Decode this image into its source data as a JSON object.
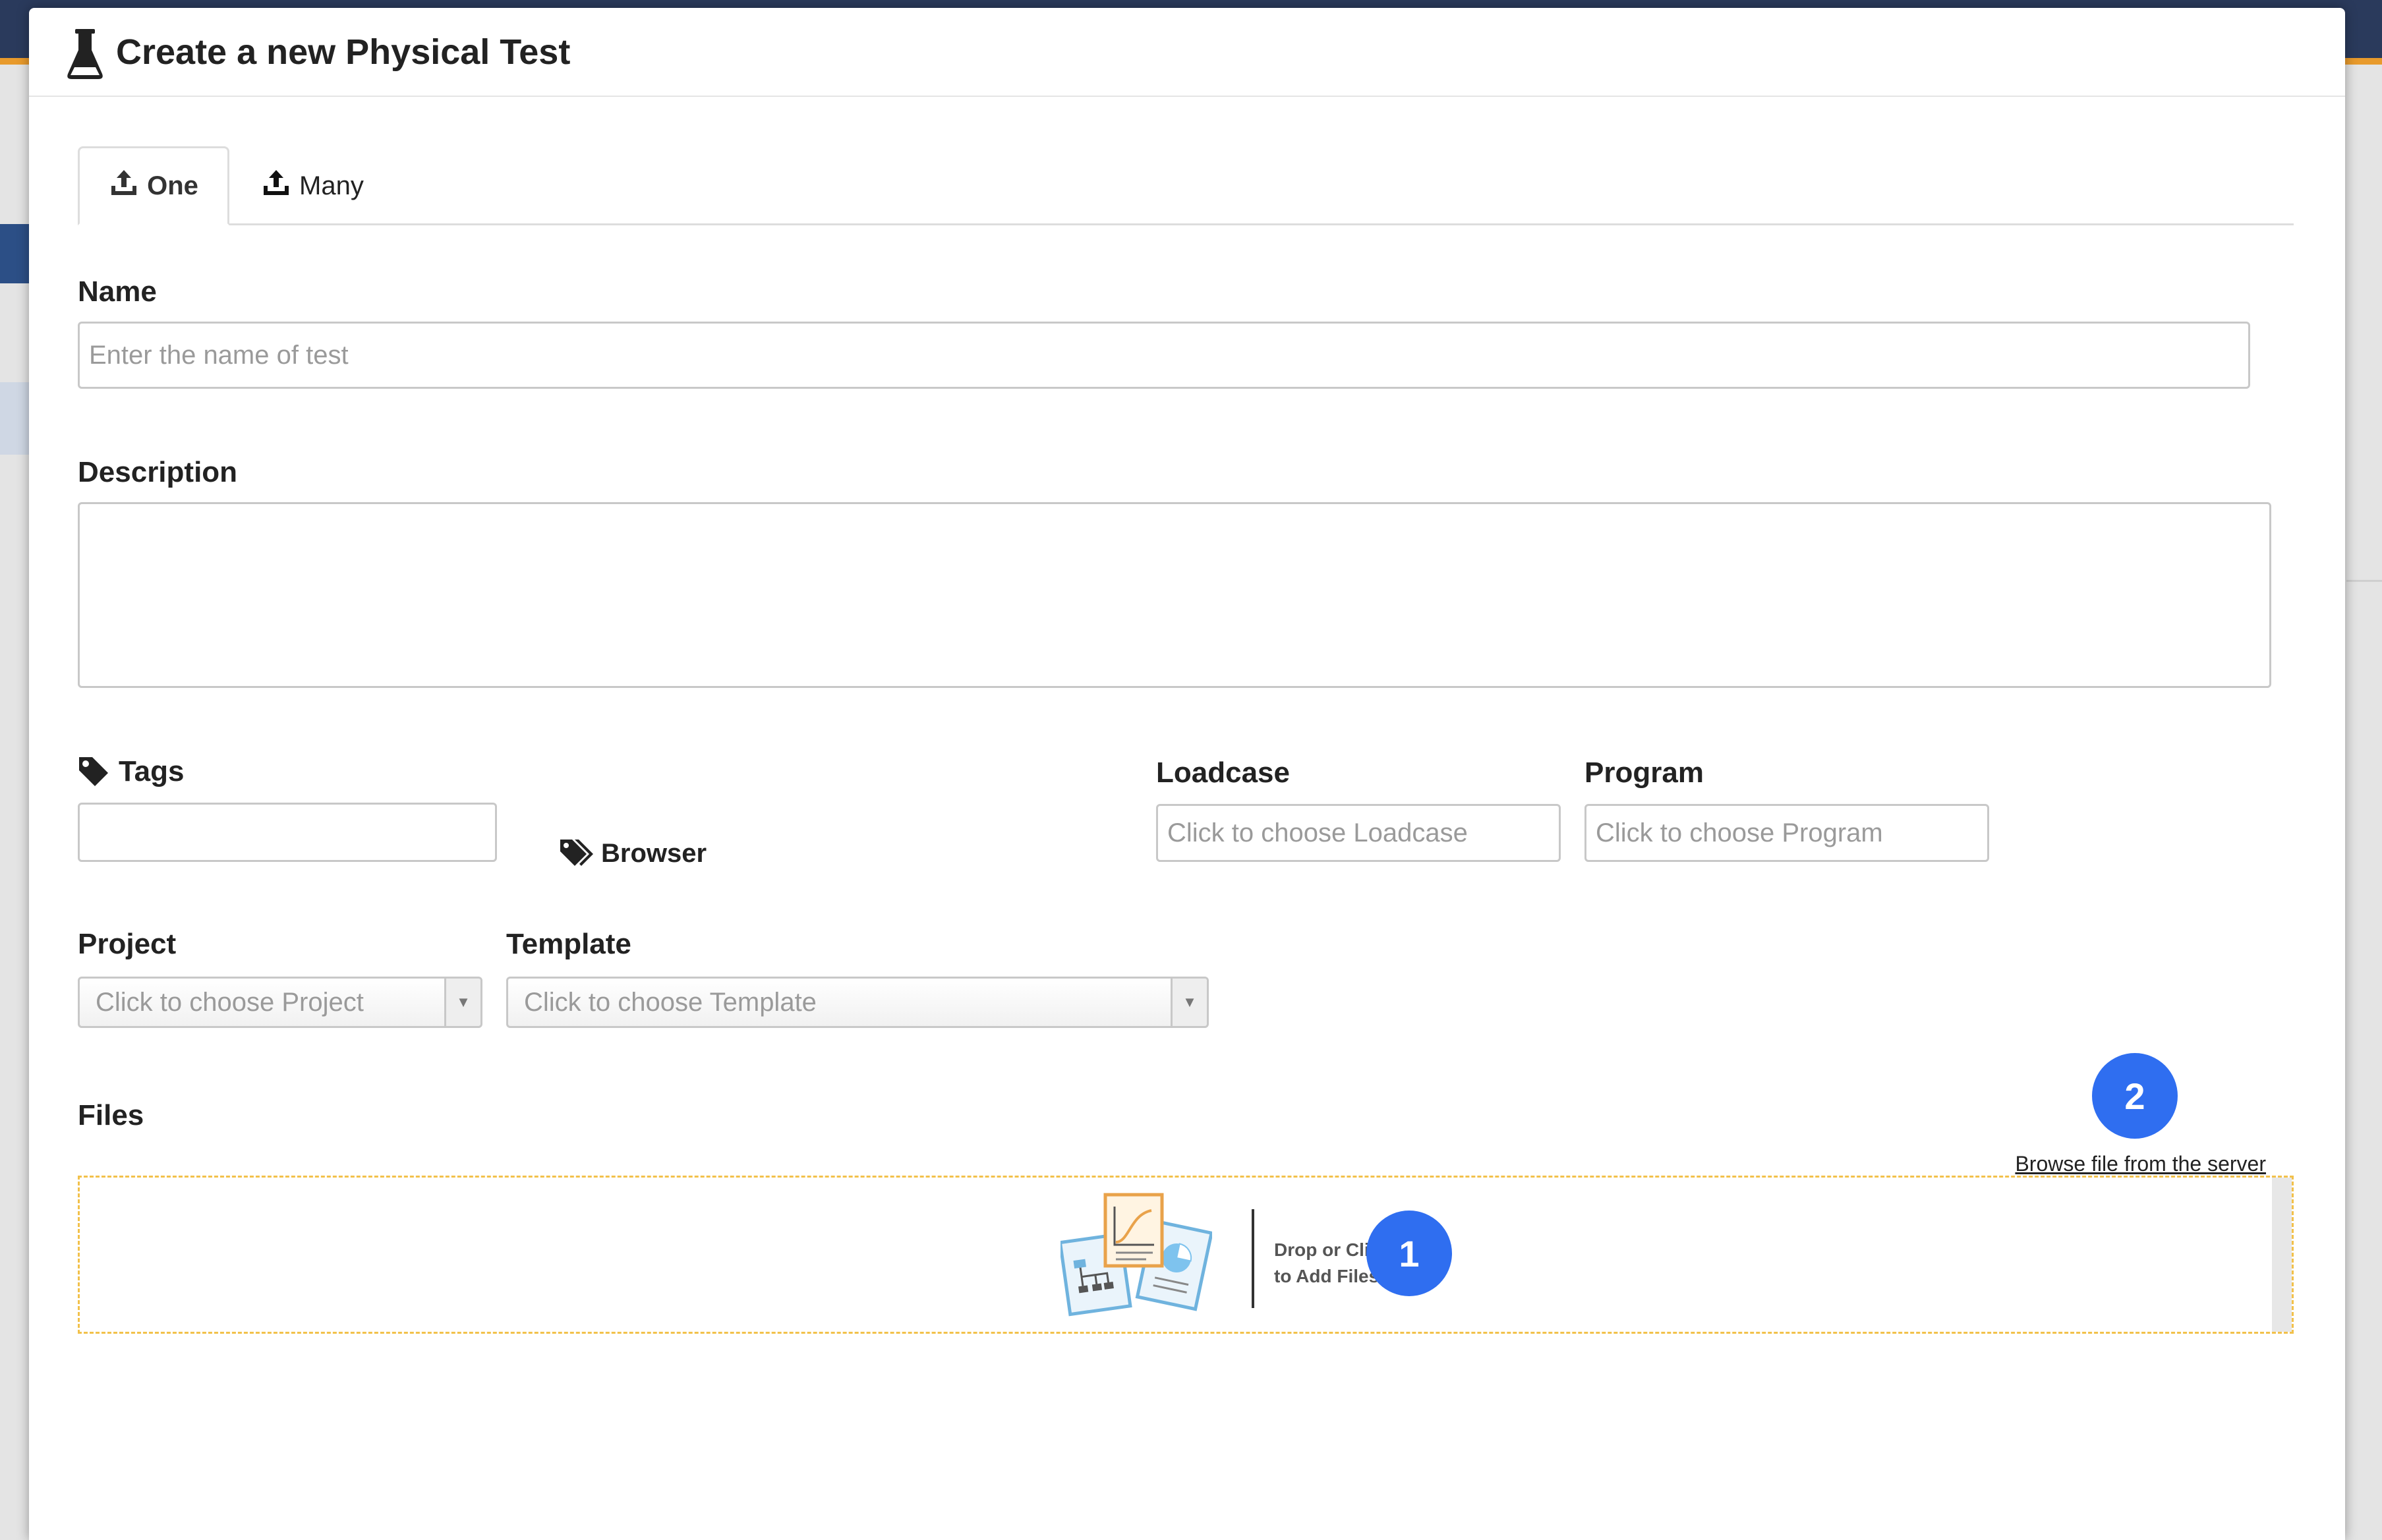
{
  "modal": {
    "title": "Create a new Physical Test",
    "title_icon": "flask-icon"
  },
  "tabs": [
    {
      "label": "One",
      "icon": "upload-icon",
      "active": true
    },
    {
      "label": "Many",
      "icon": "upload-icon",
      "active": false
    }
  ],
  "form": {
    "name": {
      "label": "Name",
      "value": "",
      "placeholder": "Enter the name of test"
    },
    "description": {
      "label": "Description",
      "value": ""
    },
    "tags": {
      "label": "Tags",
      "icon": "tag-icon",
      "value": "",
      "browser_label": "Browser",
      "browser_icon": "tags-icon"
    },
    "loadcase": {
      "label": "Loadcase",
      "placeholder": "Click to choose Loadcase"
    },
    "program": {
      "label": "Program",
      "placeholder": "Click to choose Program"
    },
    "project": {
      "label": "Project",
      "placeholder": "Click to choose Project",
      "arrow": "▼"
    },
    "template": {
      "label": "Template",
      "placeholder": "Click to choose Template",
      "arrow": "▼"
    },
    "files": {
      "label": "Files",
      "browse_server_link": "Browse file from the server",
      "dropzone_line1": "Drop or Click",
      "dropzone_line2": "to Add Files",
      "dropzone_icon": "files-illustration-icon"
    }
  },
  "badges": {
    "one": "1",
    "two": "2"
  },
  "colors": {
    "badge": "#2f6ef0",
    "dropzone_border": "#f2c14b",
    "header_bar": "#2a3a5c",
    "accent_orange": "#e89a2c"
  }
}
